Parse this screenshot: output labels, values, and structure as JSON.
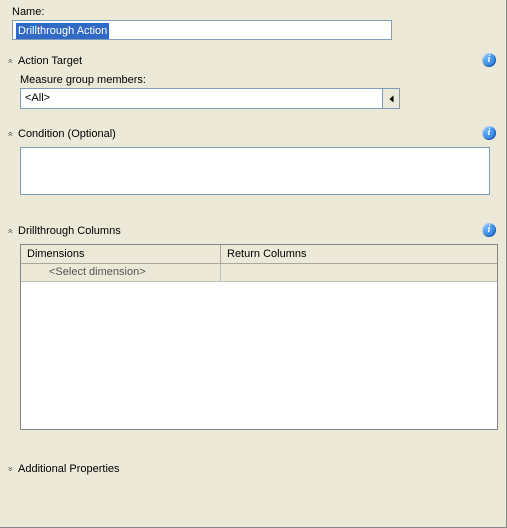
{
  "name": {
    "label": "Name:",
    "value": "Drillthrough Action"
  },
  "sections": {
    "actionTarget": {
      "title": "Action Target",
      "measureLabel": "Measure group members:",
      "measureValue": "<All>"
    },
    "condition": {
      "title": "Condition (Optional)",
      "value": ""
    },
    "drillColumns": {
      "title": "Drillthrough Columns",
      "headers": {
        "c1": "Dimensions",
        "c2": "Return Columns"
      },
      "rows": [
        {
          "dimension": "<Select dimension>",
          "ret": ""
        }
      ]
    },
    "additional": {
      "title": "Additional Properties"
    }
  },
  "icons": {
    "info": "i"
  }
}
